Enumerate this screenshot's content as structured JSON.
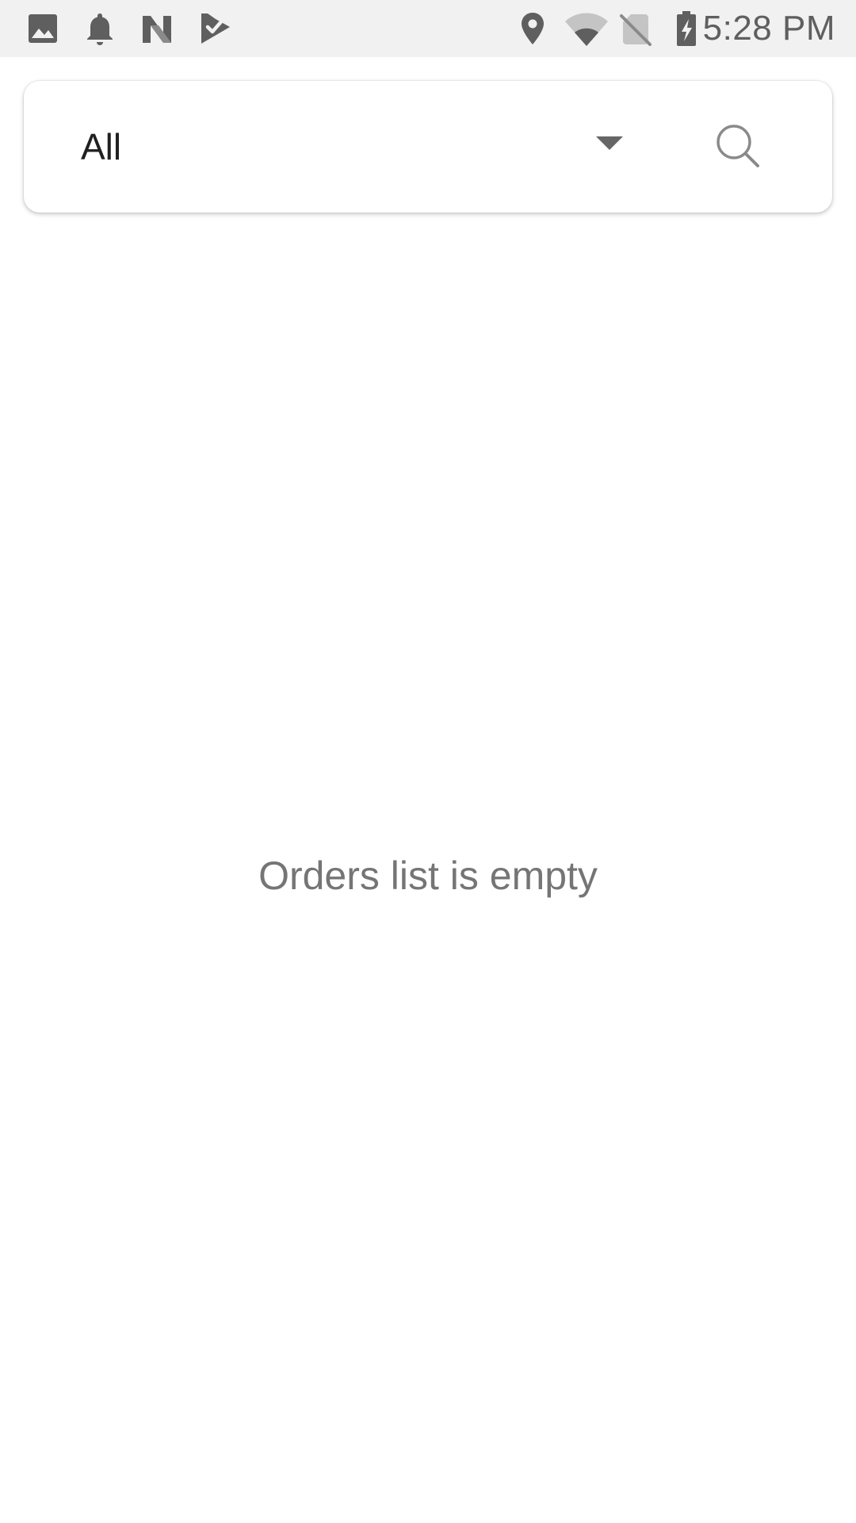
{
  "status_bar": {
    "time": "5:28 PM",
    "left_icons": [
      "image-icon",
      "bell-icon",
      "n-logo-icon",
      "task-check-icon"
    ],
    "right_icons": [
      "location-pin-icon",
      "wifi-icon",
      "no-sim-icon",
      "battery-charging-icon"
    ]
  },
  "filter": {
    "selected_value": "All",
    "dropdown_icon": "chevron-down-icon",
    "search_icon": "search-icon"
  },
  "empty_state": {
    "message": "Orders list is empty"
  },
  "colors": {
    "status_bar_bg": "#f1f1f1",
    "status_icon": "#5f5f5f",
    "primary_text": "#202020",
    "secondary_text": "#757575",
    "background": "#ffffff"
  }
}
